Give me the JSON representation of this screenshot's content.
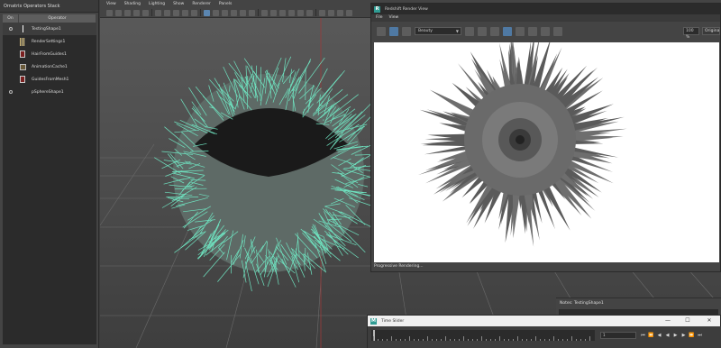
{
  "stack": {
    "title": "Ornatrix Operators Stack",
    "col_on": "On",
    "col_operator": "Operator",
    "operators": [
      {
        "label": "TestingShape1",
        "icon": "bar-icon"
      },
      {
        "label": "RenderSettings1",
        "icon": "pin-icon"
      },
      {
        "label": "HairFromGuides1",
        "icon": "pin-icon"
      },
      {
        "label": "AnimationCache1",
        "icon": "pin-icon"
      },
      {
        "label": "GuidesFromMesh1",
        "icon": "pin-icon"
      },
      {
        "label": "pSphereShape1",
        "icon": "sphere-icon"
      }
    ]
  },
  "viewport": {
    "menu": [
      "View",
      "Shading",
      "Lighting",
      "Show",
      "Renderer",
      "Panels"
    ]
  },
  "render_view": {
    "title": "Redshift Render View",
    "menu": [
      "File",
      "View"
    ],
    "aov": "Beauty",
    "zoom": "100 %",
    "origin_label": "Original",
    "status": "Progressive Rendering..."
  },
  "notes": {
    "label": "Notes: TestingShape1"
  },
  "time_slider": {
    "title": "Time Slider",
    "current_frame": "1",
    "min_btn": "—",
    "max_btn": "☐",
    "close_btn": "✕"
  },
  "colors": {
    "hair_wire": "#6fe3c0",
    "redshift_logo": "#2f9c93",
    "selected_button": "#5b86b1"
  }
}
